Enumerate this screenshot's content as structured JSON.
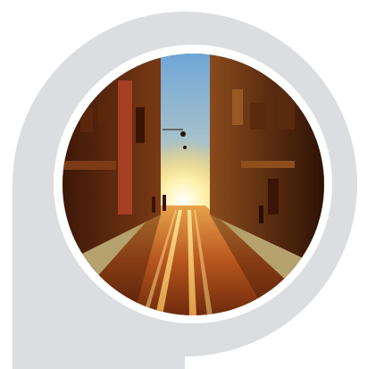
{
  "graphic": {
    "shape_icon": "map-pin-badge-icon",
    "photo_subject": "sunset-street-photo",
    "colors": {
      "badge_gray": "#dcdde1",
      "ring_white": "#ffffff",
      "sky_top": "#6fa6d8",
      "sun_glow": "#fff2a8",
      "sunset_orange": "#f2a13a",
      "building_dark": "#4a1f0a",
      "street_warm": "#c8672a"
    }
  }
}
